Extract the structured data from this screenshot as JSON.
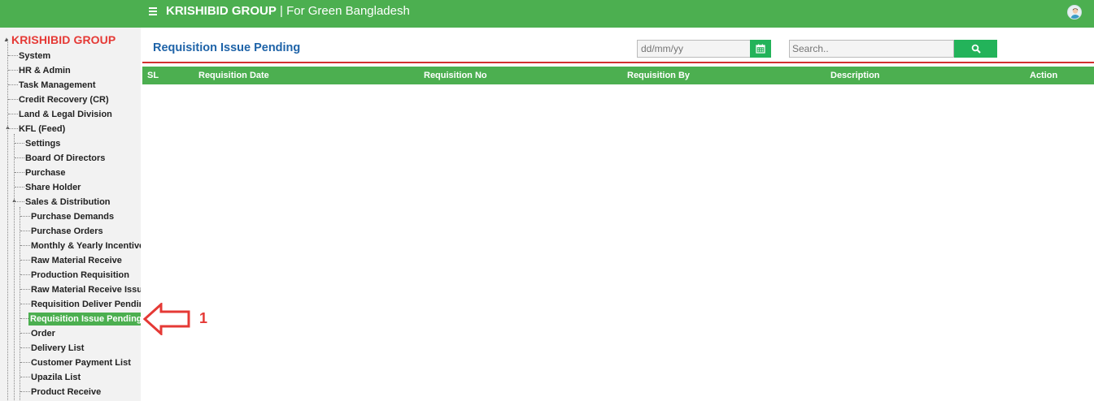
{
  "app": {
    "brand_bold": "KRISHIBID GROUP",
    "brand_separator": " | ",
    "brand_tagline": "For Green Bangladesh"
  },
  "sidebar": {
    "root": "KRISHIBID GROUP",
    "items": [
      "System",
      "HR & Admin",
      "Task Management",
      "Credit Recovery (CR)",
      "Land & Legal Division",
      "KFL (Feed)"
    ],
    "kfl_children": [
      "Settings",
      "Board Of Directors",
      "Purchase",
      "Share Holder",
      "Sales & Distribution"
    ],
    "sales_children": [
      "Purchase Demands",
      "Purchase Orders",
      "Monthly & Yearly Incentive",
      "Raw Material Receive",
      "Production Requisition",
      "Raw Material Receive Issue",
      "Requisition Deliver Pending",
      "Requisition Issue Pending",
      "Order",
      "Delivery List",
      "Customer Payment List",
      "Upazila List",
      "Product Receive"
    ],
    "active_item": "Requisition Issue Pending"
  },
  "annotation": {
    "number": "1",
    "color": "#e53935"
  },
  "main": {
    "title": "Requisition Issue Pending",
    "date_placeholder": "dd/mm/yy",
    "search_placeholder": "Search..",
    "table_headers": {
      "sl": "SL",
      "date": "Requisition Date",
      "no": "Requisition No",
      "by": "Requisition By",
      "desc": "Description",
      "action": "Action"
    },
    "rows": []
  },
  "colors": {
    "primary_green": "#4caf50",
    "button_green": "#23b35a",
    "title_blue": "#1e63a8",
    "accent_red": "#d32f2f"
  }
}
